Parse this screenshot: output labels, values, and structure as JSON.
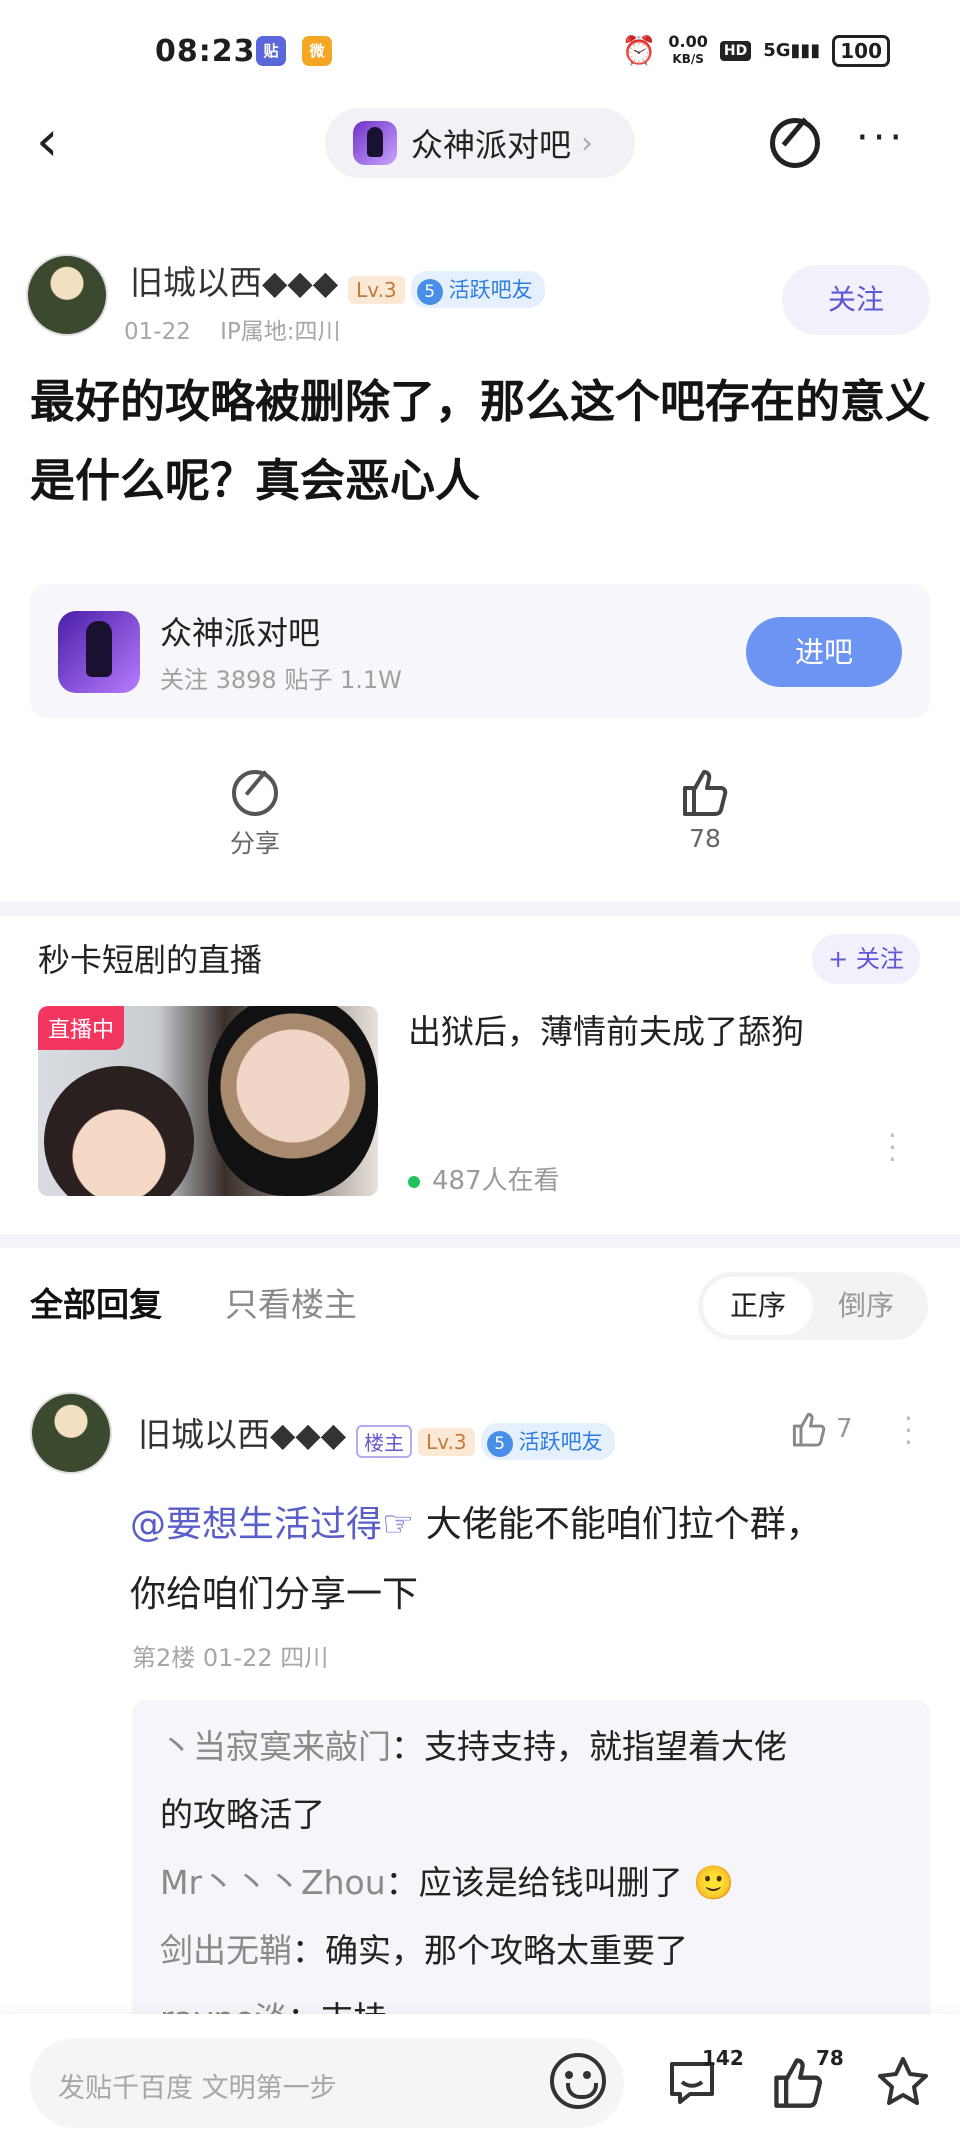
{
  "status_bar": {
    "time": "08:23",
    "app1": "贴",
    "app2": "微",
    "net_speed": "0.00",
    "net_unit": "KB/S",
    "hd": "HD",
    "signal": "5G",
    "battery": "100"
  },
  "nav": {
    "forum_name": "众神派对吧"
  },
  "post": {
    "author": "旧城以西◆◆◆",
    "level": "Lv.3",
    "badge_num": "5",
    "badge": "活跃吧友",
    "date": "01-22",
    "ip": "IP属地:四川",
    "follow": "关注",
    "title": "最好的攻略被删除了，那么这个吧存在的意义是什么呢？真会恶心人"
  },
  "forum_card": {
    "name": "众神派对吧",
    "stats": "关注 3898  贴子 1.1W",
    "join": "进吧"
  },
  "actions": {
    "share": "分享",
    "likes": "78"
  },
  "live": {
    "channel": "秒卡短剧的直播",
    "follow": "+ 关注",
    "tag": "直播中",
    "title": "出狱后，薄情前夫成了舔狗",
    "viewers": "487人在看"
  },
  "reply_tabs": {
    "all": "全部回复",
    "op_only": "只看楼主",
    "asc": "正序",
    "desc": "倒序"
  },
  "reply": {
    "author": "旧城以西◆◆◆",
    "op_tag": "楼主",
    "level": "Lv.3",
    "badge_num": "5",
    "badge": "活跃吧友",
    "likes": "7",
    "mention": "@要想生活过得☞",
    "text_1": " 大佬能不能咱们拉个群，",
    "text_2": "你给咱们分享一下",
    "meta": "第2楼  01-22  四川",
    "subs": [
      {
        "name": "丶当寂寞来敲门",
        "text": "：支持支持，就指望着大佬"
      },
      {
        "name": "",
        "text": "的攻略活了"
      },
      {
        "name": "Mr丶丶丶Zhou",
        "text": "：应该是给钱叫删了 🙂"
      },
      {
        "name": "剑出无鞘",
        "text": "：确实，那个攻略太重要了"
      },
      {
        "name": "rayne淡",
        "text": "：支持"
      }
    ]
  },
  "bottom_bar": {
    "placeholder": "发贴千百度 文明第一步",
    "comments": "142",
    "likes": "78"
  }
}
